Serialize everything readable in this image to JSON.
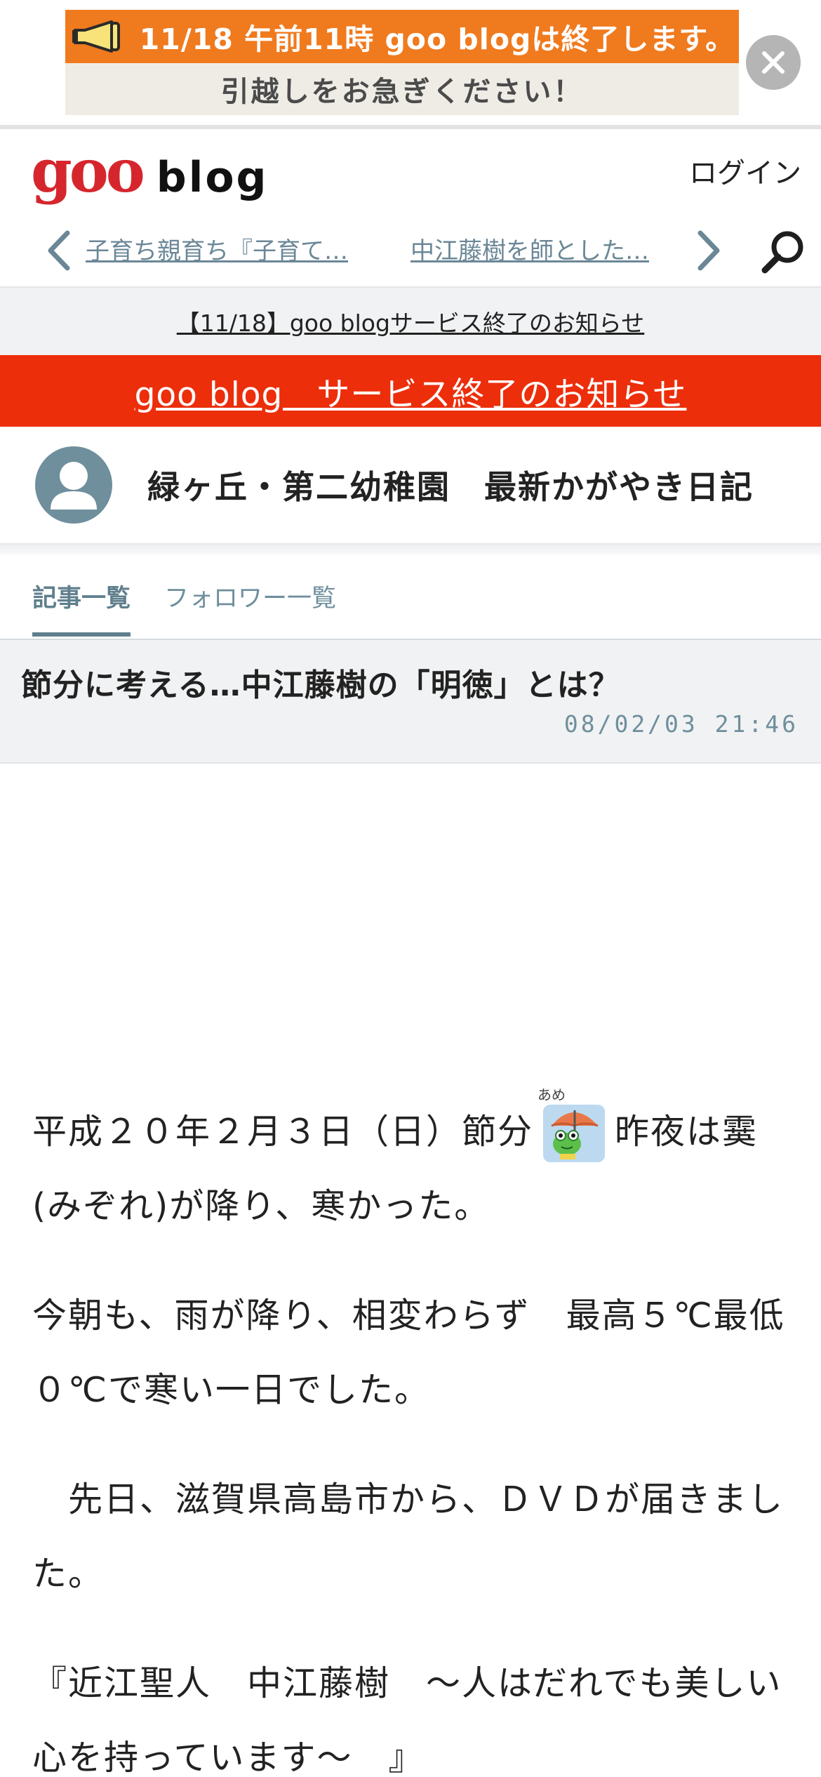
{
  "notice_banner": {
    "headline": "11/18 午前11時 goo blogは終了します。",
    "subline": "引越しをお急ぎください！",
    "close_icon": "close-icon"
  },
  "header": {
    "logo_goo": "goo",
    "logo_blog": "blog",
    "login": "ログイン"
  },
  "article_nav": {
    "prev_title": "子育ち親育ち『子育て…",
    "next_title": "中江藤樹を師とした…"
  },
  "notices": {
    "gray_link": "【11/18】goo blogサービス終了のお知らせ",
    "red_link": "goo blog　サービス終了のお知らせ"
  },
  "blog": {
    "title": "緑ヶ丘・第二幼稚園　最新かがやき日記"
  },
  "tabs": [
    {
      "label": "記事一覧",
      "active": true
    },
    {
      "label": "フォロワー一覧",
      "active": false
    }
  ],
  "entry": {
    "title": "節分に考える…中江藤樹の「明徳」とは？",
    "date": "08/02/03 21:46",
    "p1a": "平成２０年２月３日（日）節分",
    "emoji_label": "あめ",
    "p1b": "昨夜は霙(みぞれ)が降り、寒かった。",
    "p2": "今朝も、雨が降り、相変わらず　最高５℃最低０℃で寒い一日でした。",
    "p3": "　先日、滋賀県高島市から、ＤＶＤが届きました。",
    "p4": "『近江聖人　中江藤樹　～人はだれでも美しい心を持っています～　』"
  },
  "colors": {
    "banner_orange": "#f07a1e",
    "goo_red": "#d6262d",
    "notice_red": "#ec2e0b",
    "link_blue_gray": "#6b8797",
    "tab_active": "#5f7f8d"
  }
}
